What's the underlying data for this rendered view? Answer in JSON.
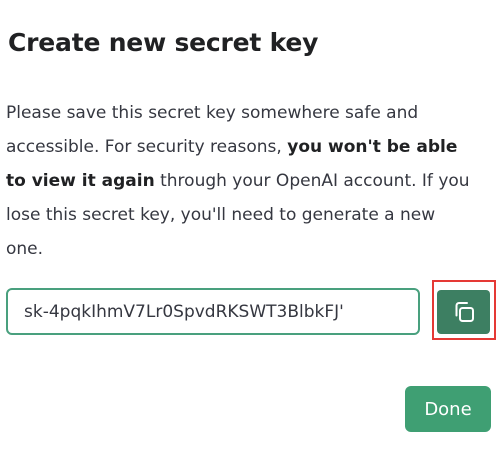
{
  "dialog": {
    "title": "Create new secret key",
    "description": {
      "part1": "Please save this secret key somewhere safe and accessible. For security reasons, ",
      "bold": "you won't be able to view it again",
      "part2": " through your OpenAI account. If you lose this secret key, you'll need to generate a new one."
    },
    "secret_key": {
      "value": "sk-4pqkIhmV7Lr0SpvdRKSWT3BlbkFJ'"
    },
    "copy_button": {
      "icon": "copy-icon",
      "highlight_color": "#e53935"
    },
    "done_button": {
      "label": "Done"
    }
  },
  "colors": {
    "accent": "#3f9f73",
    "copy_button_bg": "#3d7f62",
    "field_border": "#49a07e"
  }
}
